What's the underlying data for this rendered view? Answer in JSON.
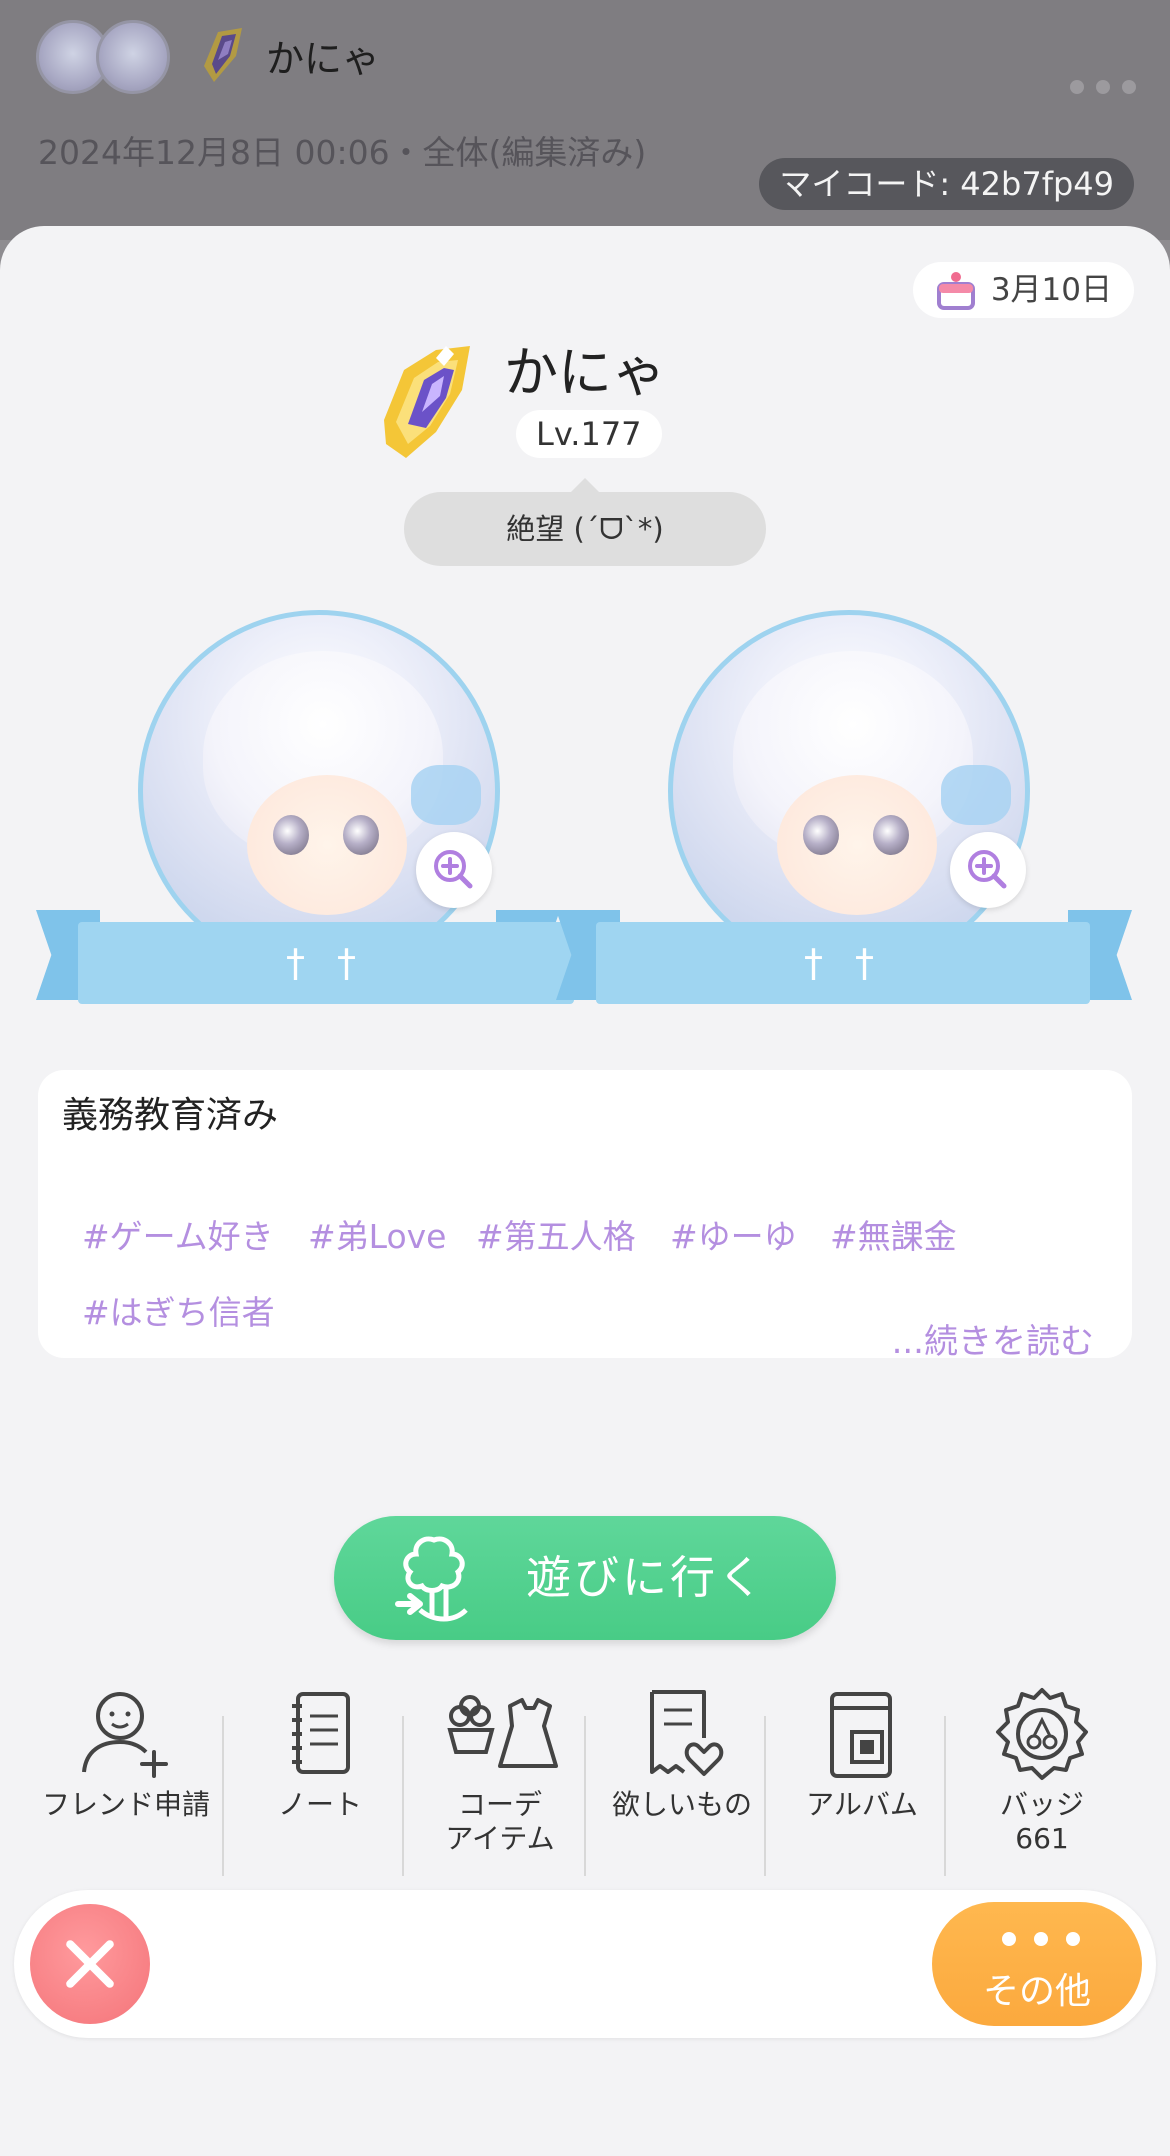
{
  "background_post": {
    "username": "かにゃ",
    "date": "2024年12月8日 00:06・全体(編集済み)",
    "my_code": "マイコード: 42b7fp49"
  },
  "profile": {
    "birthday": "3月10日",
    "name": "かにゃ",
    "level": "Lv.177",
    "status": "絶望 (´ᗜ`*)",
    "avatars": [
      {
        "ribbon": "† †"
      },
      {
        "ribbon": "† †"
      }
    ],
    "bio_title": "義務教育済み",
    "tags": [
      "#ゲーム好き",
      "#弟Love",
      "#第五人格",
      "#ゆーゆ",
      "#無課金",
      "#はぎち信者"
    ],
    "read_more": "...続きを読む"
  },
  "play_button": {
    "label": "遊びに行く"
  },
  "actions": [
    {
      "label": "フレンド申請",
      "icon": "add-friend-icon"
    },
    {
      "label": "ノート",
      "icon": "notebook-icon"
    },
    {
      "label": "コーデ",
      "label2": "アイテム",
      "icon": "outfit-items-icon"
    },
    {
      "label": "欲しいもの",
      "icon": "wishlist-icon"
    },
    {
      "label": "アルバム",
      "icon": "album-icon"
    },
    {
      "label": "バッジ",
      "label2": "661",
      "icon": "badge-icon"
    }
  ],
  "bottom_bar": {
    "other_label": "その他"
  },
  "colors": {
    "accent_purple": "#b48fe0",
    "play_green": "#48cc86",
    "ribbon_blue": "#9fd5f1",
    "close_red": "#f47479",
    "other_orange": "#fba93e"
  }
}
